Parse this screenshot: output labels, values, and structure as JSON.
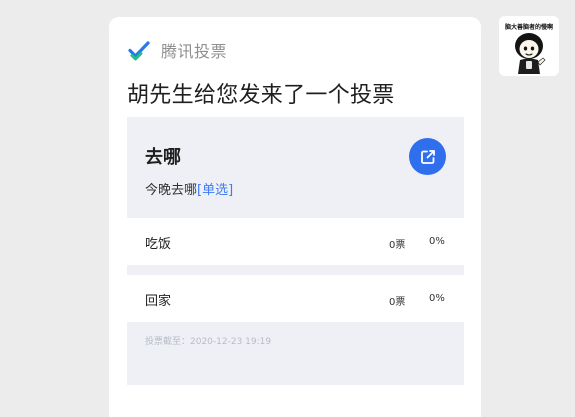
{
  "message": {
    "brand_name": "腾讯投票",
    "headline": "胡先生给您发来了一个投票"
  },
  "poll": {
    "title": "去哪",
    "subtitle": "今晚去哪",
    "type_label": "[单选]",
    "options": [
      {
        "label": "吃饭",
        "votes": "0票",
        "percent": "0%"
      },
      {
        "label": "回家",
        "votes": "0票",
        "percent": "0%"
      }
    ],
    "deadline": "投票截至：2020-12-23 19:19"
  },
  "avatar": {
    "caption": "脑大善脑者的慢啊"
  },
  "colors": {
    "accent_blue": "#2f6fee",
    "link_blue": "#3d7af5",
    "logo_blue": "#2a76f0",
    "logo_green": "#21c08a",
    "poll_background": "#eef0f5",
    "page_background": "#ececec"
  },
  "icons": {
    "brand": "tencent-vote-logo-icon",
    "open": "open-external-icon",
    "avatar": "cartoon-sticker-avatar"
  }
}
